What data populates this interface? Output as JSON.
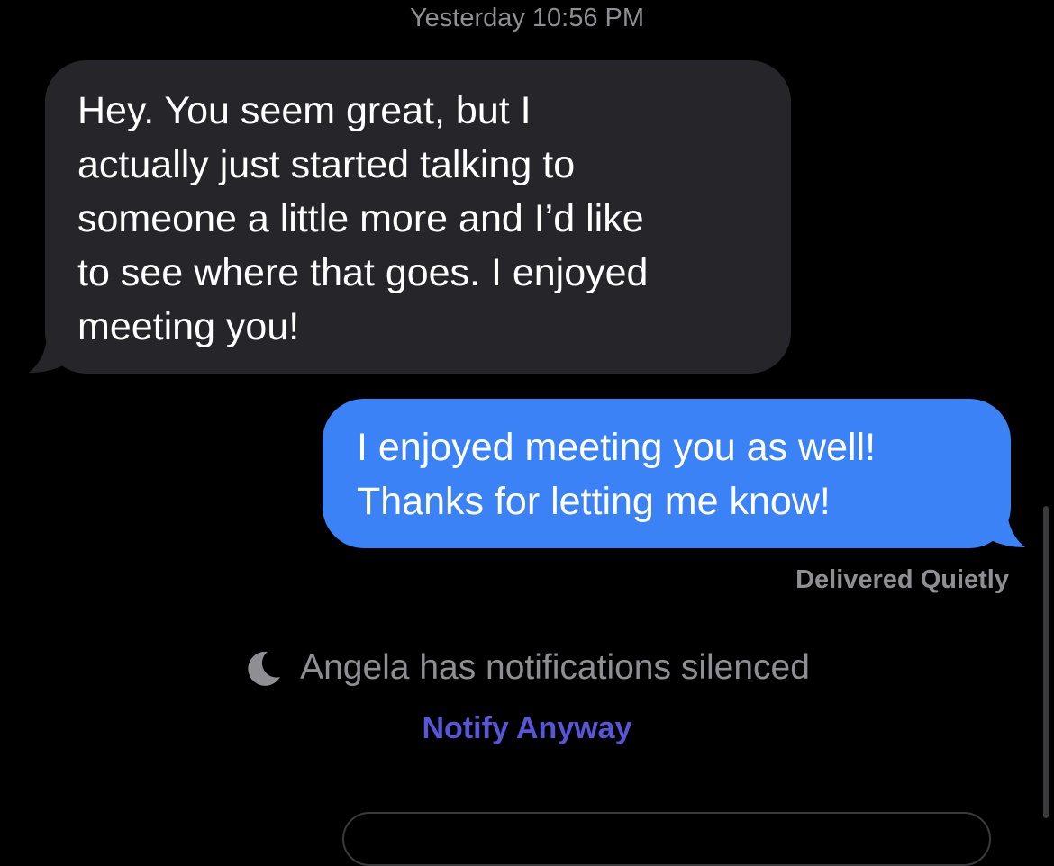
{
  "conversation": {
    "timestamp": "Yesterday 10:56 PM",
    "incoming": {
      "lines": [
        "Hey. You seem great, but I",
        "actually just started talking to",
        "someone a little more and I’d like",
        "to see where that goes. I enjoyed",
        "meeting you!"
      ]
    },
    "outgoing": {
      "lines": [
        "I enjoyed meeting you as well!",
        "Thanks for letting me know!"
      ]
    },
    "delivery_status": "Delivered Quietly",
    "focus_notice": {
      "icon": "moon-icon",
      "text": "Angela has notifications silenced",
      "action_label": "Notify Anyway"
    }
  },
  "colors": {
    "background": "#000000",
    "incoming_bubble": "#26252a",
    "outgoing_bubble": "#3b82f6",
    "secondary_text": "#8e8e93",
    "notify_link": "#5856d6"
  }
}
